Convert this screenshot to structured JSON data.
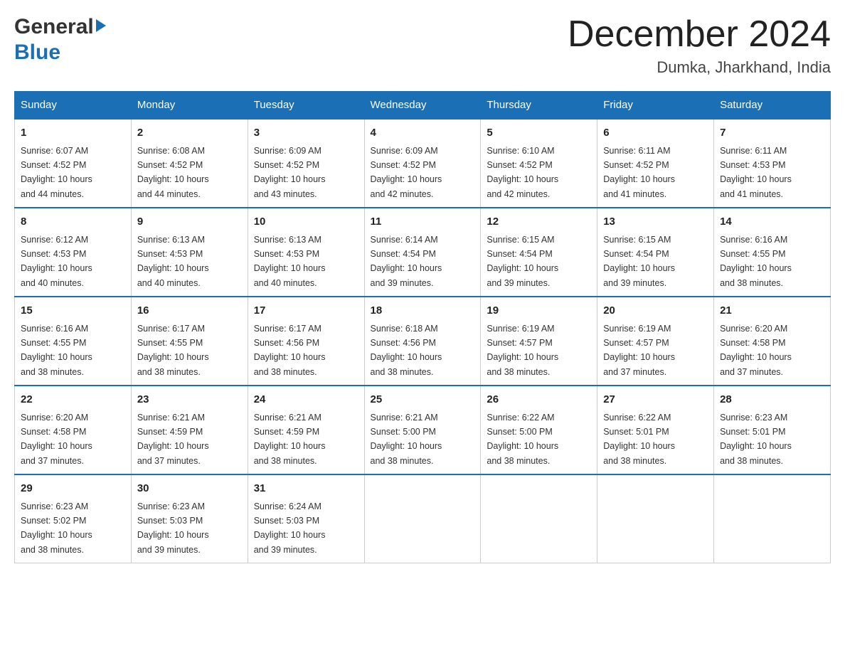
{
  "header": {
    "logo_general": "General",
    "logo_blue": "Blue",
    "month_title": "December 2024",
    "location": "Dumka, Jharkhand, India"
  },
  "days_of_week": [
    "Sunday",
    "Monday",
    "Tuesday",
    "Wednesday",
    "Thursday",
    "Friday",
    "Saturday"
  ],
  "weeks": [
    [
      {
        "day": "1",
        "sunrise": "6:07 AM",
        "sunset": "4:52 PM",
        "daylight": "10 hours and 44 minutes."
      },
      {
        "day": "2",
        "sunrise": "6:08 AM",
        "sunset": "4:52 PM",
        "daylight": "10 hours and 44 minutes."
      },
      {
        "day": "3",
        "sunrise": "6:09 AM",
        "sunset": "4:52 PM",
        "daylight": "10 hours and 43 minutes."
      },
      {
        "day": "4",
        "sunrise": "6:09 AM",
        "sunset": "4:52 PM",
        "daylight": "10 hours and 42 minutes."
      },
      {
        "day": "5",
        "sunrise": "6:10 AM",
        "sunset": "4:52 PM",
        "daylight": "10 hours and 42 minutes."
      },
      {
        "day": "6",
        "sunrise": "6:11 AM",
        "sunset": "4:52 PM",
        "daylight": "10 hours and 41 minutes."
      },
      {
        "day": "7",
        "sunrise": "6:11 AM",
        "sunset": "4:53 PM",
        "daylight": "10 hours and 41 minutes."
      }
    ],
    [
      {
        "day": "8",
        "sunrise": "6:12 AM",
        "sunset": "4:53 PM",
        "daylight": "10 hours and 40 minutes."
      },
      {
        "day": "9",
        "sunrise": "6:13 AM",
        "sunset": "4:53 PM",
        "daylight": "10 hours and 40 minutes."
      },
      {
        "day": "10",
        "sunrise": "6:13 AM",
        "sunset": "4:53 PM",
        "daylight": "10 hours and 40 minutes."
      },
      {
        "day": "11",
        "sunrise": "6:14 AM",
        "sunset": "4:54 PM",
        "daylight": "10 hours and 39 minutes."
      },
      {
        "day": "12",
        "sunrise": "6:15 AM",
        "sunset": "4:54 PM",
        "daylight": "10 hours and 39 minutes."
      },
      {
        "day": "13",
        "sunrise": "6:15 AM",
        "sunset": "4:54 PM",
        "daylight": "10 hours and 39 minutes."
      },
      {
        "day": "14",
        "sunrise": "6:16 AM",
        "sunset": "4:55 PM",
        "daylight": "10 hours and 38 minutes."
      }
    ],
    [
      {
        "day": "15",
        "sunrise": "6:16 AM",
        "sunset": "4:55 PM",
        "daylight": "10 hours and 38 minutes."
      },
      {
        "day": "16",
        "sunrise": "6:17 AM",
        "sunset": "4:55 PM",
        "daylight": "10 hours and 38 minutes."
      },
      {
        "day": "17",
        "sunrise": "6:17 AM",
        "sunset": "4:56 PM",
        "daylight": "10 hours and 38 minutes."
      },
      {
        "day": "18",
        "sunrise": "6:18 AM",
        "sunset": "4:56 PM",
        "daylight": "10 hours and 38 minutes."
      },
      {
        "day": "19",
        "sunrise": "6:19 AM",
        "sunset": "4:57 PM",
        "daylight": "10 hours and 38 minutes."
      },
      {
        "day": "20",
        "sunrise": "6:19 AM",
        "sunset": "4:57 PM",
        "daylight": "10 hours and 37 minutes."
      },
      {
        "day": "21",
        "sunrise": "6:20 AM",
        "sunset": "4:58 PM",
        "daylight": "10 hours and 37 minutes."
      }
    ],
    [
      {
        "day": "22",
        "sunrise": "6:20 AM",
        "sunset": "4:58 PM",
        "daylight": "10 hours and 37 minutes."
      },
      {
        "day": "23",
        "sunrise": "6:21 AM",
        "sunset": "4:59 PM",
        "daylight": "10 hours and 37 minutes."
      },
      {
        "day": "24",
        "sunrise": "6:21 AM",
        "sunset": "4:59 PM",
        "daylight": "10 hours and 38 minutes."
      },
      {
        "day": "25",
        "sunrise": "6:21 AM",
        "sunset": "5:00 PM",
        "daylight": "10 hours and 38 minutes."
      },
      {
        "day": "26",
        "sunrise": "6:22 AM",
        "sunset": "5:00 PM",
        "daylight": "10 hours and 38 minutes."
      },
      {
        "day": "27",
        "sunrise": "6:22 AM",
        "sunset": "5:01 PM",
        "daylight": "10 hours and 38 minutes."
      },
      {
        "day": "28",
        "sunrise": "6:23 AM",
        "sunset": "5:01 PM",
        "daylight": "10 hours and 38 minutes."
      }
    ],
    [
      {
        "day": "29",
        "sunrise": "6:23 AM",
        "sunset": "5:02 PM",
        "daylight": "10 hours and 38 minutes."
      },
      {
        "day": "30",
        "sunrise": "6:23 AM",
        "sunset": "5:03 PM",
        "daylight": "10 hours and 39 minutes."
      },
      {
        "day": "31",
        "sunrise": "6:24 AM",
        "sunset": "5:03 PM",
        "daylight": "10 hours and 39 minutes."
      },
      null,
      null,
      null,
      null
    ]
  ],
  "labels": {
    "sunrise": "Sunrise:",
    "sunset": "Sunset:",
    "daylight": "Daylight:"
  }
}
